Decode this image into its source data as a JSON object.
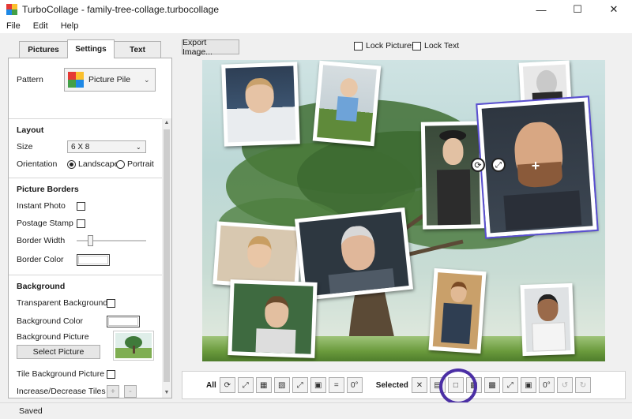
{
  "window": {
    "title": "TurboCollage - family-tree-collage.turbocollage",
    "minimize": "—",
    "maximize": "☐",
    "close": "✕"
  },
  "menu": [
    "File",
    "Edit",
    "Help"
  ],
  "tabs": [
    "Pictures",
    "Settings",
    "Text"
  ],
  "active_tab": "Settings",
  "pattern": {
    "label": "Pattern",
    "value": "Picture Pile"
  },
  "layout": {
    "title": "Layout",
    "size_label": "Size",
    "size_value": "6 X 8",
    "orientation_label": "Orientation",
    "landscape": "Landscape",
    "portrait": "Portrait",
    "selected_orientation": "Landscape"
  },
  "borders": {
    "title": "Picture Borders",
    "instant_photo": "Instant Photo",
    "postage_stamp": "Postage Stamp",
    "border_width": "Border Width",
    "border_color": "Border Color"
  },
  "background": {
    "title": "Background",
    "transparent": "Transparent Background",
    "color": "Background Color",
    "picture": "Background Picture",
    "select_picture": "Select Picture",
    "tile": "Tile Background Picture",
    "tiles": "Increase/Decrease Tiles",
    "plus": "+",
    "minus": "-"
  },
  "top_bar": {
    "export": "Export Image...",
    "lock_pictures": "Lock Pictures",
    "lock_text": "Lock Text"
  },
  "toolbar": {
    "all": "All",
    "selected": "Selected"
  },
  "status": "Saved",
  "colors": {
    "accent_ring": "#4b2fa5",
    "selection": "#5a4fd0"
  }
}
